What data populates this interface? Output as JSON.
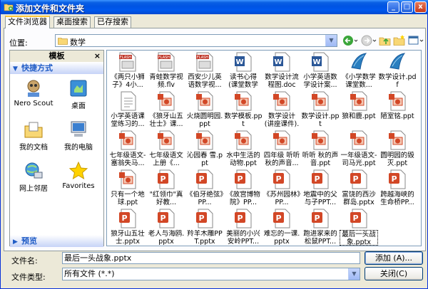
{
  "window": {
    "title": "添加文件和文件夹",
    "controls": [
      "_",
      "□",
      "x"
    ]
  },
  "tabs": [
    {
      "label": "文件浏览器"
    },
    {
      "label": "桌面搜索"
    },
    {
      "label": "已存搜索"
    }
  ],
  "location": {
    "label": "位置:",
    "value": "数学"
  },
  "left_pane": {
    "title": "模板",
    "close": "×",
    "section_favorites": "快捷方式",
    "section_preview": "预览",
    "places": [
      {
        "label": "Nero Scout",
        "icon": "nero-scout-icon"
      },
      {
        "label": "桌面",
        "icon": "desktop-icon"
      },
      {
        "label": "我的文档",
        "icon": "my-documents-icon"
      },
      {
        "label": "我的电脑",
        "icon": "my-computer-icon"
      },
      {
        "label": "网上邻居",
        "icon": "network-places-icon"
      },
      {
        "label": "Favorites",
        "icon": "favorites-star-icon"
      }
    ]
  },
  "files": [
    {
      "name": "《两只小狮子》4小...",
      "type": "flash"
    },
    {
      "name": "青蛙数学视频.flv",
      "type": "flash"
    },
    {
      "name": "西安少儿英语数学视...",
      "type": "flash"
    },
    {
      "name": "读书心得 (课堂数学设...",
      "type": "word"
    },
    {
      "name": "数学设计流程图.doc",
      "type": "word"
    },
    {
      "name": "小学英语数学设计案...",
      "type": "word"
    },
    {
      "name": "《小学数学课堂数...",
      "type": "pdf"
    },
    {
      "name": "数学设计.pdf",
      "type": "pdf"
    },
    {
      "name": "小学英语课堂练习的...",
      "type": "doc-plain"
    },
    {
      "name": "《狼牙山五壮士》课...",
      "type": "ppt"
    },
    {
      "name": "火烧圆明园.ppt",
      "type": "ppt"
    },
    {
      "name": "数学模板.ppt",
      "type": "ppt"
    },
    {
      "name": "数学设计 (讲座课件).ppt",
      "type": "ppt"
    },
    {
      "name": "数学设计.ppt",
      "type": "ppt"
    },
    {
      "name": "狼和鹿.ppt",
      "type": "ppt"
    },
    {
      "name": "陋室铭.ppt",
      "type": "ppt"
    },
    {
      "name": "七年级语文-塞翁失马...",
      "type": "ppt"
    },
    {
      "name": "七年级语文上册《...",
      "type": "ppt"
    },
    {
      "name": "沁园春 雪.ppt",
      "type": "ppt"
    },
    {
      "name": "水中生活的动物.ppt",
      "type": "ppt"
    },
    {
      "name": "四年级 听听秋的声音...",
      "type": "ppt"
    },
    {
      "name": "听听 秋的声音.ppt",
      "type": "ppt"
    },
    {
      "name": "一年级语文-司马光.ppt",
      "type": "ppt"
    },
    {
      "name": "圆明园的毁灭.ppt",
      "type": "ppt"
    },
    {
      "name": "只有一个地球.ppt",
      "type": "ppt"
    },
    {
      "name": "\"红领巾\"真好教...",
      "type": "pptx"
    },
    {
      "name": "《伯牙绝弦》PP...",
      "type": "pptx"
    },
    {
      "name": "《故宫博物院》PP...",
      "type": "pptx"
    },
    {
      "name": "《苏州园林》PP...",
      "type": "pptx"
    },
    {
      "name": "地震中的父与子PPT...",
      "type": "pptx"
    },
    {
      "name": "富饶的西沙群岛.pptx",
      "type": "pptx"
    },
    {
      "name": "跨越海峡的生命桥PP...",
      "type": "pptx"
    },
    {
      "name": "狼牙山五壮士.pptx",
      "type": "pptx"
    },
    {
      "name": "老人与海鸥.pptx",
      "type": "pptx"
    },
    {
      "name": "羚羊木雕PPT.pptx",
      "type": "pptx"
    },
    {
      "name": "美丽的小兴安岭PPT...",
      "type": "pptx"
    },
    {
      "name": "难忘的一课.pptx",
      "type": "pptx"
    },
    {
      "name": "跑进家来的松鼠PPT...",
      "type": "pptx"
    },
    {
      "name": "最后一头战象.pptx",
      "type": "pptx",
      "selected": true
    }
  ],
  "filename": {
    "label": "文件名:",
    "value": "最后一头战象.pptx"
  },
  "filetype": {
    "label": "文件类型:",
    "value": "所有文件 (*.*)"
  },
  "buttons": {
    "add": "添加 (A)...",
    "close": "关闭(C)"
  },
  "colors": {
    "titlebar": "#0054e3",
    "selection": "#316ac5",
    "ppt": "#d24726",
    "word": "#2b5797"
  }
}
